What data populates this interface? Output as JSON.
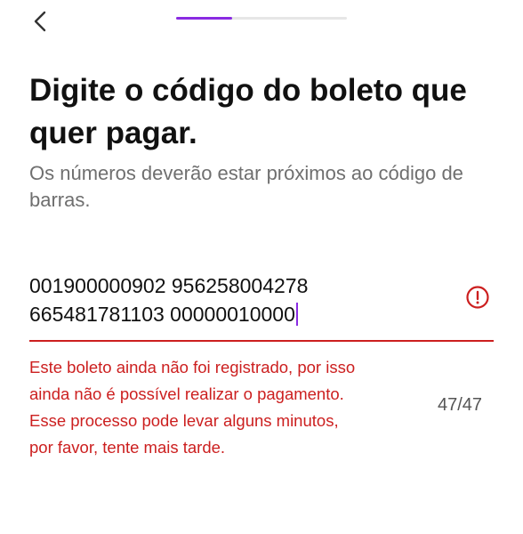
{
  "colors": {
    "accent": "#8a2be2",
    "error": "#cc1f1f",
    "track": "#e6e6e6"
  },
  "header": {
    "back_icon": "chevron-left-icon",
    "progress_fraction": 0.33
  },
  "main": {
    "title": "Digite o código do boleto que quer pagar.",
    "subtitle": "Os números deverão estar próximos ao código de barras.",
    "code_field": {
      "value": "001900000902 956258004278\n665481781103 00000010000",
      "error_icon": "alert-circle-icon",
      "counter": "47/47"
    },
    "error_lines": [
      "Este boleto ainda não foi registrado, por isso",
      "ainda não é possível realizar o pagamento.",
      "Esse processo pode levar alguns minutos,",
      "por favor, tente mais tarde."
    ]
  }
}
